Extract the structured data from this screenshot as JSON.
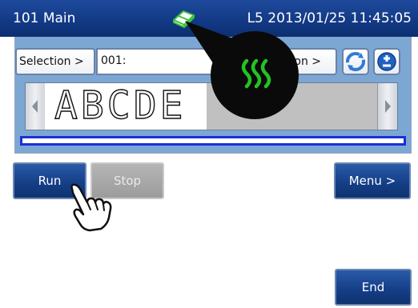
{
  "titlebar": {
    "screen_label": "101 Main",
    "status": "L5 2013/01/25 11:45:05",
    "status_icon": "eraser-icon",
    "background": "#123a86"
  },
  "message_panel": {
    "selection_left_label": "Selection >",
    "message_number": "001:",
    "selection_right_label": "tion >",
    "refresh_icon": "refresh-icon",
    "plusminus_icon": "plus-minus-icon",
    "preview_text": "ABCDE",
    "panel_color": "#7da7d3",
    "progress_color": "#1a2fd6"
  },
  "heater_overlay": {
    "icon": "heat-wave-icon",
    "icon_color": "#22c322"
  },
  "buttons": {
    "run": "Run",
    "stop": "Stop",
    "menu": "Menu >",
    "end": "End"
  },
  "pointer": {
    "icon": "pointing-hand-icon"
  }
}
